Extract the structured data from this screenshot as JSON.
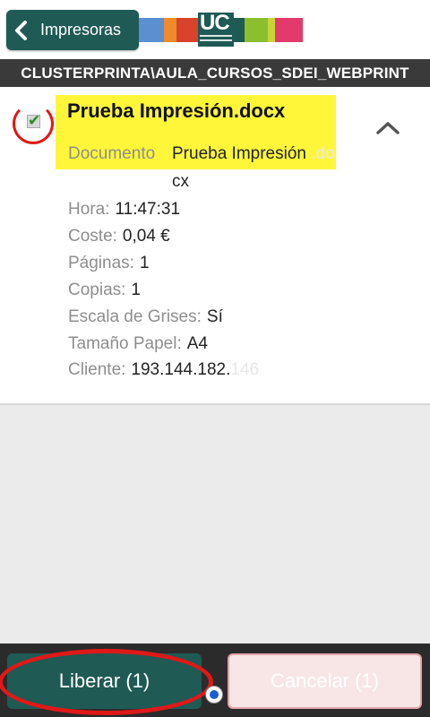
{
  "header": {
    "back_label": "Impresoras",
    "logo_text": "UC",
    "strip_colors": [
      "#5a8fd0",
      "#f08a2a",
      "#d9432b",
      "#ffffff",
      "#ffffff",
      "#8bbf2e",
      "#c9d43a",
      "#e23a6c"
    ]
  },
  "printer_path": "CLUSTERPRINTA\\AULA_CURSOS_SDEI_WEBPRINT",
  "job": {
    "title": "Prueba Impresión.docx",
    "checked": true,
    "document_label": "Documento",
    "document_value_line1": "Prueba Impresión",
    "document_value_ghost": ".do",
    "document_value_line2": "cx",
    "fields": [
      {
        "label": "Hora:",
        "value": "11:47:31"
      },
      {
        "label": "Coste:",
        "value": "0,04 €"
      },
      {
        "label": "Páginas:",
        "value": "1"
      },
      {
        "label": "Copias:",
        "value": "1"
      },
      {
        "label": "Escala de Grises:",
        "value": "Sí"
      },
      {
        "label": "Tamaño Papel:",
        "value": "A4"
      },
      {
        "label": "Cliente:",
        "value": "193.144.182."
      }
    ],
    "client_ghost": "146"
  },
  "actions": {
    "release_label": "Liberar (1)",
    "cancel_label": "Cancelar (1)"
  },
  "colors": {
    "primary": "#1f5a55",
    "highlight": "#fff63a",
    "annotation": "#e01818",
    "cancel_bg": "#f8e6e7"
  }
}
